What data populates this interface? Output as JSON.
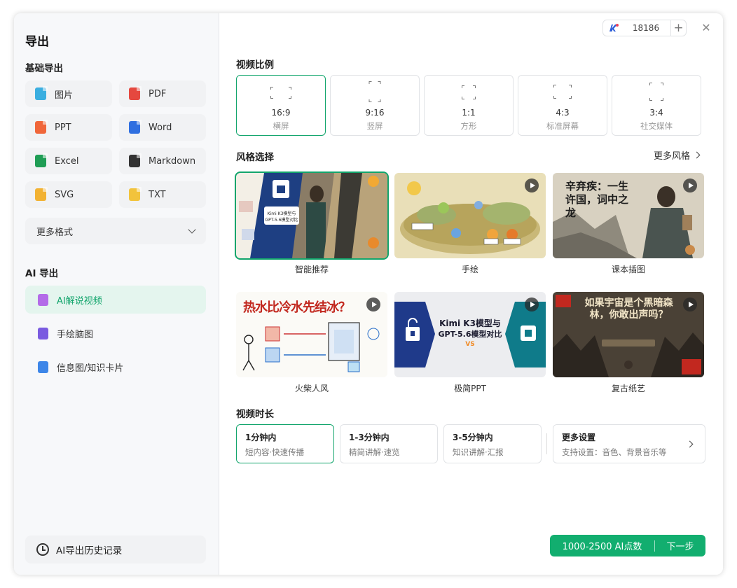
{
  "dialog": {
    "title": "导出"
  },
  "basic": {
    "heading": "基础导出",
    "formats": [
      {
        "label": "图片",
        "icon": "image-file-icon",
        "color": "#3aaee0"
      },
      {
        "label": "PDF",
        "icon": "pdf-file-icon",
        "color": "#e5483f"
      },
      {
        "label": "PPT",
        "icon": "ppt-file-icon",
        "color": "#f0663a"
      },
      {
        "label": "Word",
        "icon": "word-file-icon",
        "color": "#2f6fe0"
      },
      {
        "label": "Excel",
        "icon": "excel-file-icon",
        "color": "#1f9d55"
      },
      {
        "label": "Markdown",
        "icon": "markdown-file-icon",
        "color": "#333333"
      },
      {
        "label": "SVG",
        "icon": "svg-file-icon",
        "color": "#f2b233"
      },
      {
        "label": "TXT",
        "icon": "txt-file-icon",
        "color": "#f2c33c"
      }
    ],
    "more_label": "更多格式"
  },
  "ai": {
    "heading": "AI 导出",
    "items": [
      {
        "label": "AI解说视频",
        "icon": "ai-video-icon",
        "color": "#b36be8"
      },
      {
        "label": "手绘脑图",
        "icon": "mindmap-icon",
        "color": "#7a5be0"
      },
      {
        "label": "信息图/知识卡片",
        "icon": "infographic-icon",
        "color": "#3d86e8"
      }
    ],
    "selected_index": 0
  },
  "history": {
    "label": "AI导出历史记录"
  },
  "credits": {
    "value": "18186"
  },
  "ratio": {
    "heading": "视频比例",
    "options": [
      {
        "label": "16:9",
        "sub": "横屏"
      },
      {
        "label": "9:16",
        "sub": "竖屏"
      },
      {
        "label": "1:1",
        "sub": "方形"
      },
      {
        "label": "4:3",
        "sub": "标准屏幕"
      },
      {
        "label": "3:4",
        "sub": "社交媒体"
      }
    ],
    "selected_index": 0
  },
  "style": {
    "heading": "风格选择",
    "more_label": "更多风格",
    "cards": [
      {
        "label": "智能推荐"
      },
      {
        "label": "手绘"
      },
      {
        "label": "课本插图",
        "art_text": "辛弃疾：一生许国，词中之龙"
      },
      {
        "label": "火柴人风",
        "art_text": "热水比冷水先结冰？"
      },
      {
        "label": "极简PPT",
        "art_text_1": "Kimi K3模型与",
        "art_text_2": "GPT-5.6模型对比",
        "art_vs": "VS"
      },
      {
        "label": "复古纸艺",
        "art_text": "如果宇宙是个黑暗森林，你敢出声吗？"
      }
    ],
    "selected_index": 0
  },
  "duration": {
    "heading": "视频时长",
    "options": [
      {
        "title": "1分钟内",
        "sub": "短内容·快速传播"
      },
      {
        "title": "1-3分钟内",
        "sub": "精简讲解·速览"
      },
      {
        "title": "3-5分钟内",
        "sub": "知识讲解·汇报"
      },
      {
        "title": "更多设置",
        "sub": "支持设置：音色、背景音乐等"
      }
    ],
    "selected_index": 0
  },
  "footer": {
    "cost_label": "1000-2500 AI点数",
    "next_label": "下一步"
  },
  "colors": {
    "accent": "#12a56c",
    "button": "#12ae6f"
  }
}
